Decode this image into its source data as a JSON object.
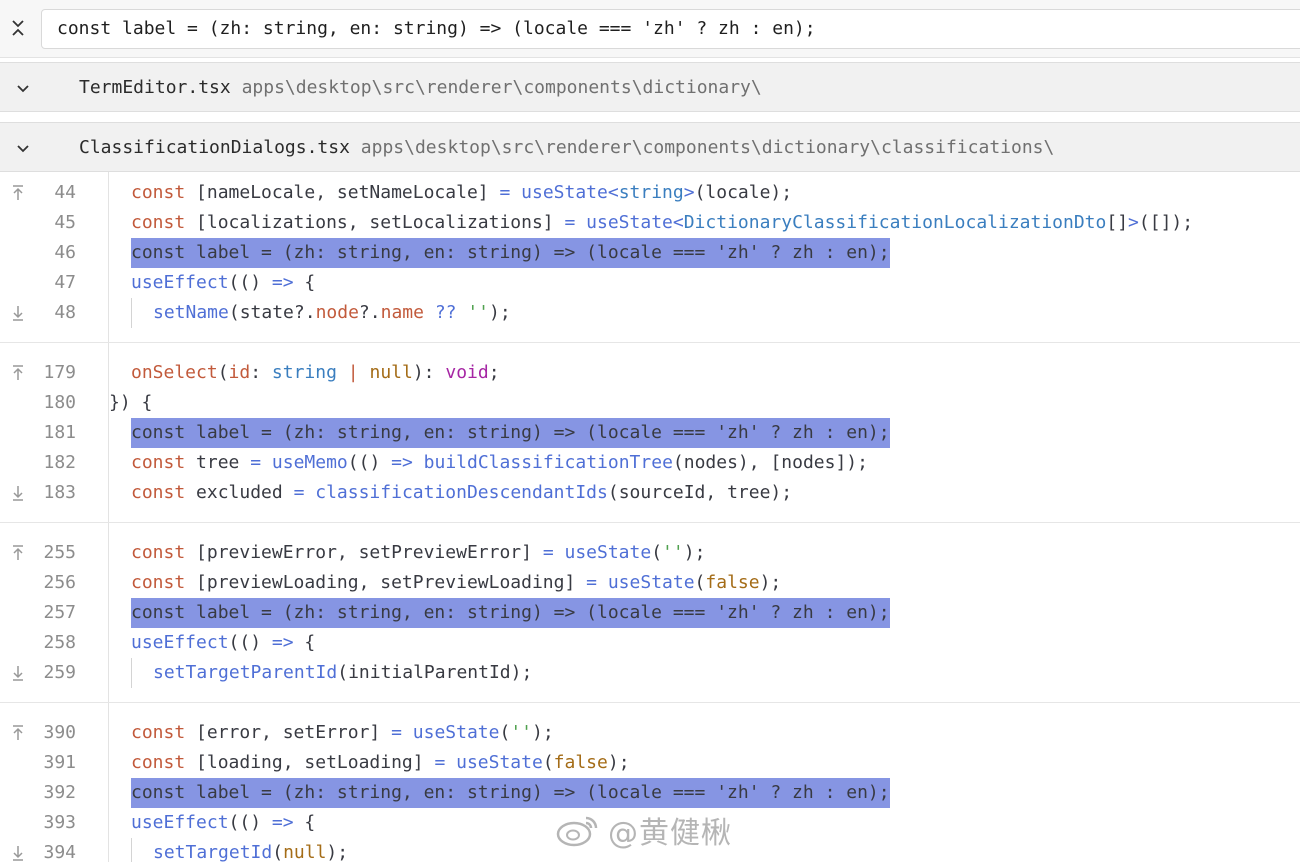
{
  "search": {
    "query": "const label = (zh: string, en: string) => (locale === 'zh' ? zh : en);"
  },
  "files": [
    {
      "name": "TermEditor.tsx",
      "path": "apps\\desktop\\src\\renderer\\components\\dictionary\\"
    },
    {
      "name": "ClassificationDialogs.tsx",
      "path": "apps\\desktop\\src\\renderer\\components\\dictionary\\classifications\\"
    }
  ],
  "hunks": [
    {
      "lines": [
        {
          "n": "44",
          "text": "const [nameLocale, setNameLocale] = useState<string>(locale);"
        },
        {
          "n": "45",
          "text": "const [localizations, setLocalizations] = useState<DictionaryClassificationLocalizationDto[]>([]);"
        },
        {
          "n": "46",
          "text": "const label = (zh: string, en: string) => (locale === 'zh' ? zh : en);",
          "match": true
        },
        {
          "n": "47",
          "text": "useEffect(() => {"
        },
        {
          "n": "48",
          "text": "setName(state?.node?.name ?? '');"
        }
      ]
    },
    {
      "lines": [
        {
          "n": "179",
          "text": "onSelect(id: string | null): void;"
        },
        {
          "n": "180",
          "text": "}) {"
        },
        {
          "n": "181",
          "text": "const label = (zh: string, en: string) => (locale === 'zh' ? zh : en);",
          "match": true
        },
        {
          "n": "182",
          "text": "const tree = useMemo(() => buildClassificationTree(nodes), [nodes]);"
        },
        {
          "n": "183",
          "text": "const excluded = classificationDescendantIds(sourceId, tree);"
        }
      ]
    },
    {
      "lines": [
        {
          "n": "255",
          "text": "const [previewError, setPreviewError] = useState('');"
        },
        {
          "n": "256",
          "text": "const [previewLoading, setPreviewLoading] = useState(false);"
        },
        {
          "n": "257",
          "text": "const label = (zh: string, en: string) => (locale === 'zh' ? zh : en);",
          "match": true
        },
        {
          "n": "258",
          "text": "useEffect(() => {"
        },
        {
          "n": "259",
          "text": "setTargetParentId(initialParentId);"
        }
      ]
    },
    {
      "lines": [
        {
          "n": "390",
          "text": "const [error, setError] = useState('');"
        },
        {
          "n": "391",
          "text": "const [loading, setLoading] = useState(false);"
        },
        {
          "n": "392",
          "text": "const label = (zh: string, en: string) => (locale === 'zh' ? zh : en);",
          "match": true
        },
        {
          "n": "393",
          "text": "useEffect(() => {"
        },
        {
          "n": "394",
          "text": "setTargetId(null);"
        }
      ]
    }
  ],
  "watermark": {
    "text": "@黄健楸"
  },
  "colors": {
    "match_highlight": "#8695e3",
    "header_bg": "#f1f1f1"
  }
}
